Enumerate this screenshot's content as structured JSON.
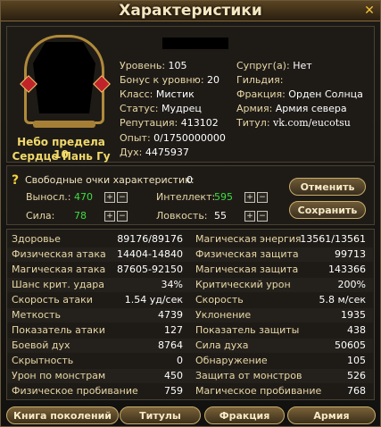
{
  "window": {
    "title": "Характеристики",
    "close_icon": "close-x-icon"
  },
  "profile": {
    "line1": "Небо предела 10",
    "line2": "Сердце Пань Гу",
    "left": [
      {
        "label": "Уровень:",
        "value": "105"
      },
      {
        "label": "Бонус к уровню:",
        "value": "20"
      },
      {
        "label": "Класс:",
        "value": "Мистик"
      },
      {
        "label": "Статус:",
        "value": "Мудрец"
      },
      {
        "label": "Репутация:",
        "value": "413102"
      },
      {
        "label": "Опыт:",
        "value": "0/1750000000"
      },
      {
        "label": "Дух:",
        "value": "4475937"
      }
    ],
    "right": [
      {
        "label": "Супруг(а):",
        "value": "Нет"
      },
      {
        "label": "Гильдия:",
        "value": ""
      },
      {
        "label": "Фракция:",
        "value": "Орден Солнца"
      },
      {
        "label": "Армия:",
        "value": "Армия севера"
      },
      {
        "label": "Титул:",
        "value": "vk.com/eucotsu"
      }
    ]
  },
  "points": {
    "title": "Свободные очки характеристик:",
    "free": "0",
    "stats": [
      {
        "label": "Выносл.:",
        "value": "470"
      },
      {
        "label": "Сила:",
        "value": "78"
      },
      {
        "label": "Интеллект:",
        "value": "595"
      },
      {
        "label": "Ловкость:",
        "value": "55"
      }
    ],
    "plus": "+",
    "minus": "−",
    "cancel": "Отменить",
    "save": "Сохранить"
  },
  "stats": [
    [
      "Здоровье",
      "89176/89176",
      "Магическая энергия",
      "13561/13561"
    ],
    [
      "Физическая атака",
      "14404-14840",
      "Физическая защита",
      "99713"
    ],
    [
      "Магическая атака",
      "87605-92150",
      "Магическая защита",
      "143366"
    ],
    [
      "Шанс крит. удара",
      "34%",
      "Критический урон",
      "200%"
    ],
    [
      "Скорость атаки",
      "1.54 уд/сек",
      "Скорость",
      "5.8 м/сек"
    ],
    [
      "Меткость",
      "4739",
      "Уклонение",
      "1935"
    ],
    [
      "Показатель атаки",
      "127",
      "Показатель защиты",
      "438"
    ],
    [
      "Боевой дух",
      "8764",
      "Сила духа",
      "50605"
    ],
    [
      "Скрытность",
      "0",
      "Обнаружение",
      "105"
    ],
    [
      "Урон по монстрам",
      "450",
      "Защита от монстров",
      "526"
    ],
    [
      "Физическое пробивание",
      "759",
      "Магическое пробивание",
      "768"
    ]
  ],
  "footer": [
    "Книга поколений",
    "Титулы",
    "Фракция",
    "Армия"
  ]
}
